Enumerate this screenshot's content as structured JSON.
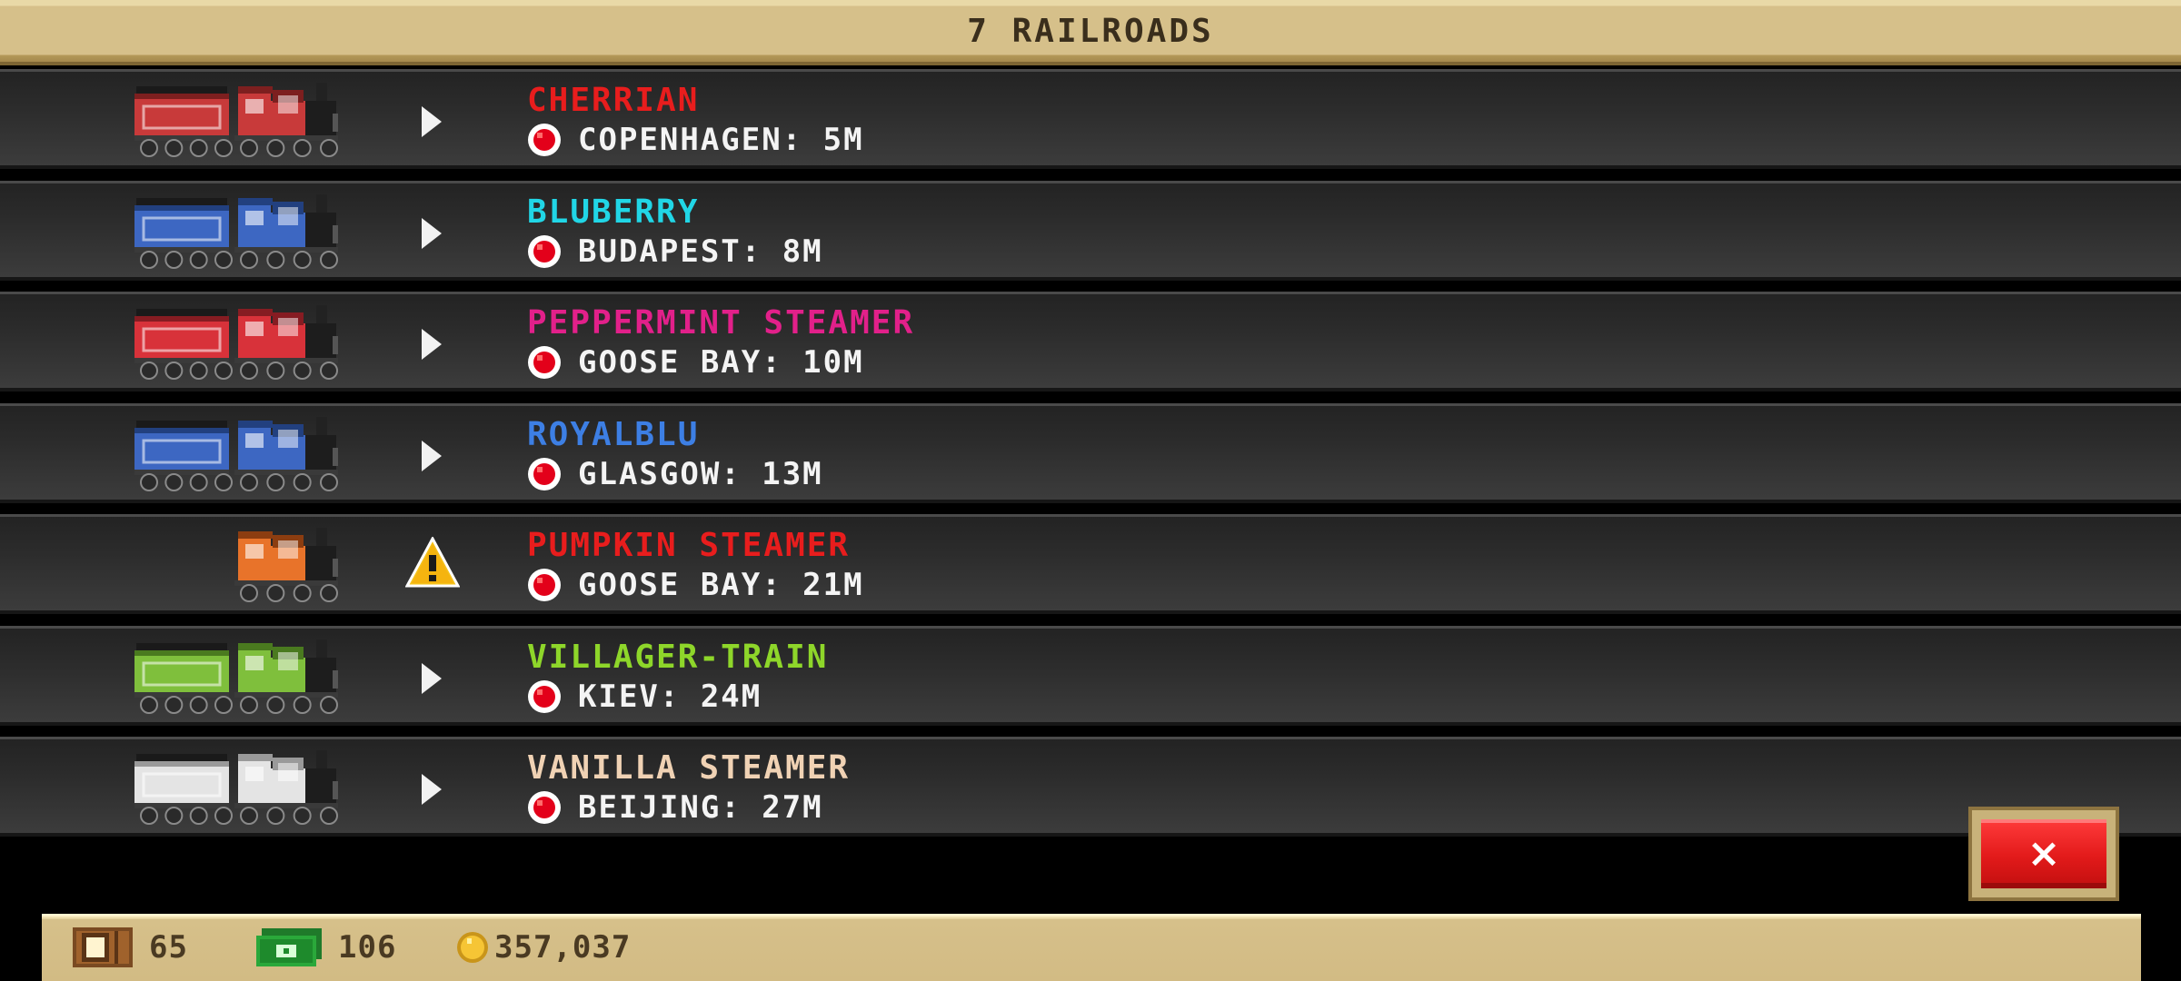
{
  "header": {
    "title": "7 RAILROADS"
  },
  "railroads": [
    {
      "name": "CHERRIAN",
      "name_color": "#e81d1d",
      "destination": "COPENHAGEN: 5M",
      "status_icon": "arrow",
      "tender": true,
      "body_color": "#c83a3a",
      "dark_color": "#7d1f1f"
    },
    {
      "name": "BLUBERRY",
      "name_color": "#21d6e6",
      "destination": "BUDAPEST: 8M",
      "status_icon": "arrow",
      "tender": true,
      "body_color": "#3d67c2",
      "dark_color": "#22407f"
    },
    {
      "name": "PEPPERMINT STEAMER",
      "name_color": "#e2208a",
      "destination": "GOOSE BAY: 10M",
      "status_icon": "arrow",
      "tender": true,
      "body_color": "#d8323a",
      "dark_color": "#861c22"
    },
    {
      "name": "ROYALBLU",
      "name_color": "#3d7fe4",
      "destination": "GLASGOW: 13M",
      "status_icon": "arrow",
      "tender": true,
      "body_color": "#3d67c2",
      "dark_color": "#22407f"
    },
    {
      "name": "PUMPKIN STEAMER",
      "name_color": "#e81d1d",
      "destination": "GOOSE BAY: 21M",
      "status_icon": "warning",
      "tender": false,
      "body_color": "#e8732a",
      "dark_color": "#8c3d10"
    },
    {
      "name": "VILLAGER-TRAIN",
      "name_color": "#8ed62a",
      "destination": "KIEV: 24M",
      "status_icon": "arrow",
      "tender": true,
      "body_color": "#7fbf3c",
      "dark_color": "#4a7a1f"
    },
    {
      "name": "VANILLA STEAMER",
      "name_color": "#f0d2b4",
      "destination": "BEIJING: 27M",
      "status_icon": "arrow",
      "tender": true,
      "body_color": "#e4e4e4",
      "dark_color": "#9a9a9a"
    }
  ],
  "close_button": {
    "label": "×"
  },
  "footer": {
    "crates": "65",
    "cash": "106",
    "coins": "357,037"
  },
  "colors": {
    "panel_tan": "#d6c08a",
    "row_dark": "#2c2c2c",
    "close_red": "#e21a1a"
  }
}
